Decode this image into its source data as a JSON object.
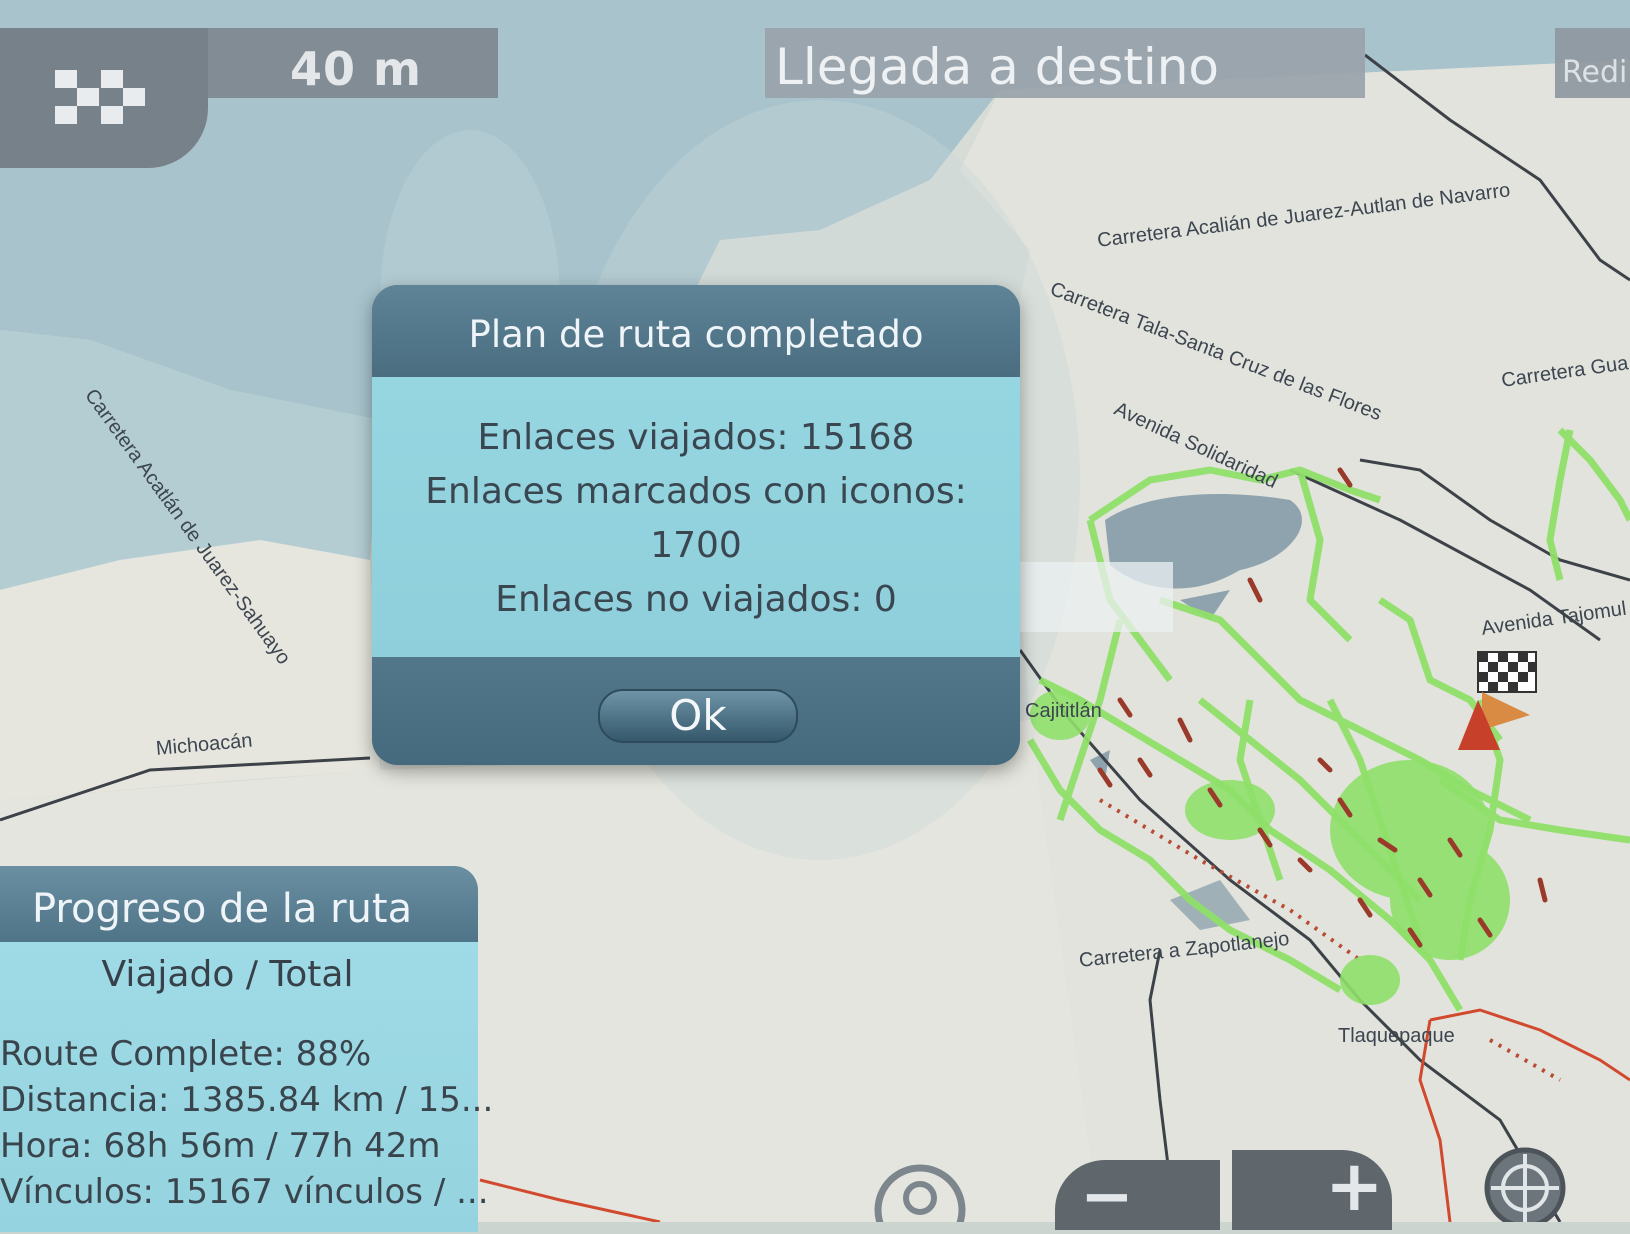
{
  "topbar": {
    "distance": "40 m",
    "message": "Llegada a destino",
    "right_button": "Redi"
  },
  "map": {
    "labels": [
      "Carretera Acalián de Juarez-Autlan de Navarro",
      "Carretera Tala-Santa Cruz de las Flores",
      "Carretera Gua",
      "Avenida Solidaridad",
      "Carretera Acatlán de Juarez-Sahuayo",
      "Michoacán",
      "Cajititlán",
      "Avenida Tajomul",
      "Carretera a Zapotlanejo",
      "Tlaquepaque"
    ]
  },
  "dialog": {
    "title": "Plan de ruta completado",
    "line1": "Enlaces viajados: 15168",
    "line2": "Enlaces marcados con iconos:",
    "line3": "1700",
    "line4": "Enlaces no viajados: 0",
    "ok": "Ok"
  },
  "progress": {
    "title": "Progreso de la ruta",
    "subtitle": "Viajado / Total",
    "route_complete": "Route Complete: 88%",
    "distance": "Distancia: 1385.84 km / 15...",
    "time": "Hora: 68h 56m / 77h 42m",
    "links": "Vínculos: 15167 vínculos / ..."
  },
  "controls": {
    "zoom_out": "−",
    "zoom_in": "+"
  },
  "colors": {
    "route_green": "#8fe06a",
    "dialog_body": "#96d6e1",
    "dialog_header": "#4d7184"
  }
}
